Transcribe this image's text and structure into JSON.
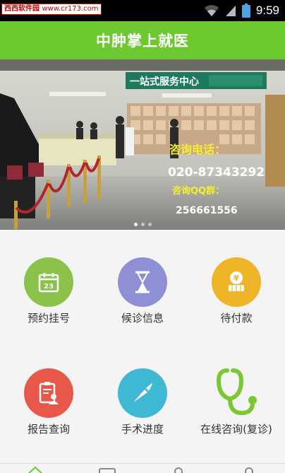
{
  "status_bar": {
    "watermark_name": "西西软件园",
    "watermark_url": "www.cr173.com",
    "time": "9:59",
    "icons": [
      "wifi-icon",
      "signal-icon",
      "battery-icon"
    ]
  },
  "header": {
    "title": "中肿掌上就医"
  },
  "banner": {
    "signboard_text": "一站式服务中心",
    "consult_phone_label": "咨询电话：",
    "consult_phone": "020-87343292",
    "qq_group_label": "咨询QQ群：",
    "qq_group": "256661556",
    "page_count": 3,
    "active_page": 0
  },
  "menu": [
    {
      "label": "预约挂号",
      "icon": "calendar-icon",
      "color": "#8bc34a",
      "day": "23"
    },
    {
      "label": "候诊信息",
      "icon": "hourglass-icon",
      "color": "#8f8fd6"
    },
    {
      "label": "待付款",
      "icon": "payment-icon",
      "color": "#f0b429"
    },
    {
      "label": "报告查询",
      "icon": "report-icon",
      "color": "#e8584a"
    },
    {
      "label": "手术进度",
      "icon": "scalpel-icon",
      "color": "#3fb8d6"
    },
    {
      "label": "在线咨询(复诊)",
      "icon": "stethoscope-icon",
      "color": "#7bc832"
    }
  ],
  "tabbar": {
    "icons": [
      "home-icon",
      "card-icon",
      "person-icon",
      "profile-icon"
    ]
  },
  "colors": {
    "brand_green": "#6ec82f",
    "status_bar": "#000000",
    "background": "#f4f4f4"
  }
}
